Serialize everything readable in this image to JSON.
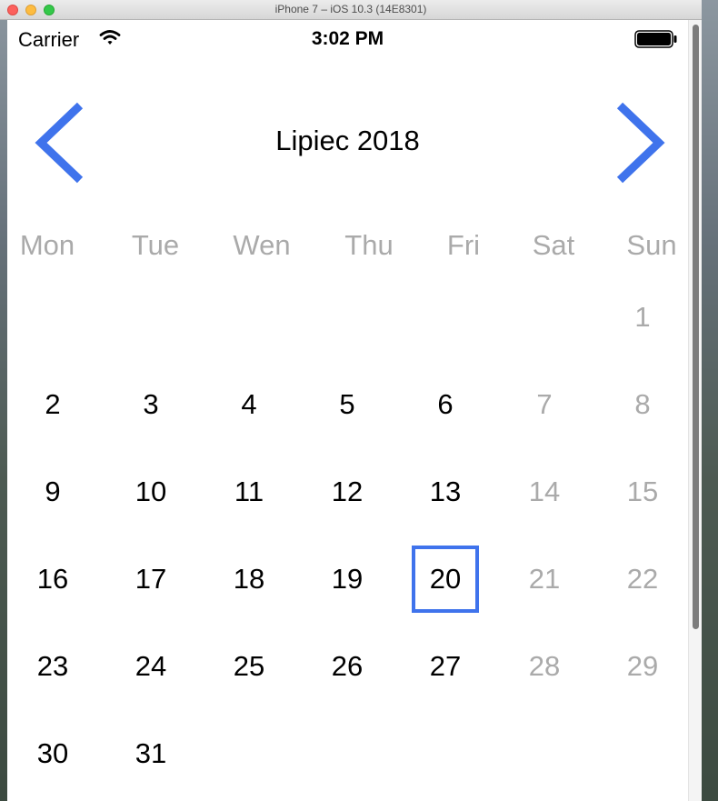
{
  "window": {
    "title": "iPhone 7 – iOS 10.3 (14E8301)"
  },
  "status_bar": {
    "carrier": "Carrier",
    "time": "3:02 PM"
  },
  "calendar": {
    "month_title": "Lipiec 2018",
    "weekdays": [
      "Mon",
      "Tue",
      "Wen",
      "Thu",
      "Fri",
      "Sat",
      "Sun"
    ],
    "first_weekday_index": 6,
    "days_in_month": 31,
    "selected_day": 20,
    "weekend_color": "#aaaaaa",
    "accent_color": "#3f73ec"
  }
}
